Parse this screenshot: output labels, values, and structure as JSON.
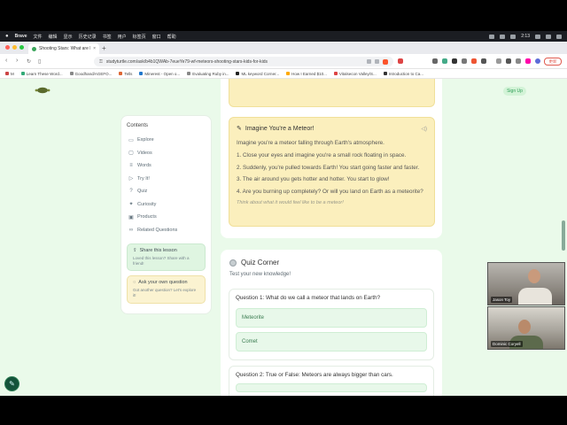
{
  "menubar": {
    "app": "Brave",
    "items": [
      "文件",
      "编辑",
      "显示",
      "历史记录",
      "书签",
      "用户",
      "标签页",
      "窗口",
      "帮助"
    ],
    "clock": "2:13"
  },
  "browser": {
    "tab_title": "Shooting Stars: What are Met...",
    "url": "studyturtle.com/ask/b4b1QWAb-7eueYe79-wf-meteors-shooting-stars-kids-for-kids",
    "update_label": "更新",
    "bookmarks": [
      "M",
      "Learn These Word...",
      "Goodhand/AGEFO...",
      "Tells",
      "Minerest - Open o...",
      "Evaluating Ruby in...",
      "ML keyword Corner...",
      "How I Earned $10...",
      "Vitalsecon Valley/S...",
      "Introduction to Ca..."
    ]
  },
  "page": {
    "signup": "Sign Up"
  },
  "sidebar": {
    "title": "Contents",
    "items": [
      {
        "label": "Explore",
        "icon": "book-icon"
      },
      {
        "label": "Videos",
        "icon": "video-icon"
      },
      {
        "label": "Words",
        "icon": "words-icon"
      },
      {
        "label": "Try It!",
        "icon": "arrow-icon"
      },
      {
        "label": "Quiz",
        "icon": "question-icon"
      },
      {
        "label": "Curiosity",
        "icon": "rocket-icon"
      },
      {
        "label": "Products",
        "icon": "box-icon"
      },
      {
        "label": "Related Questions",
        "icon": "link-icon"
      }
    ],
    "share": {
      "title": "Share this lesson",
      "text": "Loved this lesson? Share with a friend!"
    },
    "ask": {
      "title": "Ask your own question",
      "text": "Got another question? Let's explore it!"
    }
  },
  "activity": {
    "title": "Imagine You're a Meteor!",
    "intro": "Imagine you're a meteor falling through Earth's atmosphere.",
    "steps": [
      "1. Close your eyes and imagine you're a small rock floating in space.",
      "2. Suddenly, you're pulled towards Earth! You start going faster and faster.",
      "3. The air around you gets hotter and hotter. You start to glow!",
      "4. Are you burning up completely? Or will you land on Earth as a meteorite?"
    ],
    "note": "Think about what it would feel like to be a meteor!"
  },
  "quiz": {
    "title": "Quiz Corner",
    "subtitle": "Test your new knowledge!",
    "q1": {
      "text": "Question 1: What do we call a meteor that lands on Earth?",
      "options": [
        "Meteorite",
        "Comet"
      ]
    },
    "q2": {
      "text": "Question 2: True or False: Meteors are always bigger than cars."
    }
  },
  "video_call": {
    "participants": [
      "Jason Toy",
      "Dominic Coryell"
    ]
  },
  "colors": {
    "accent_green": "#2f9e57",
    "page_bg": "#eafaea",
    "activity_bg": "#fbefbd"
  }
}
